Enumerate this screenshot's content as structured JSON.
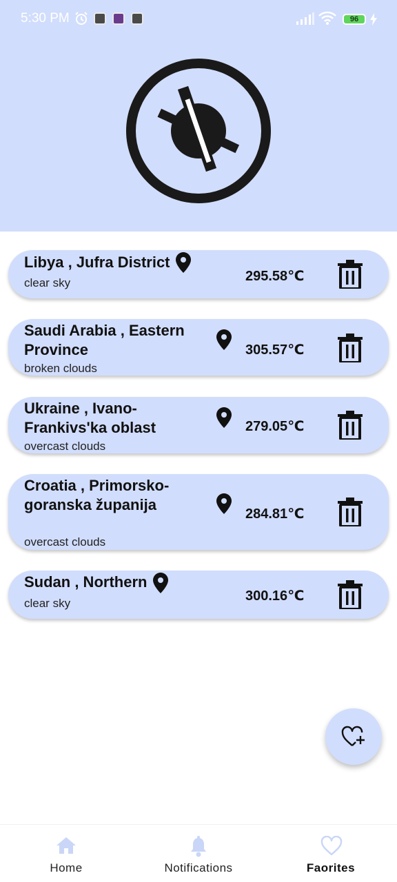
{
  "status_bar": {
    "time": "5:30 PM",
    "battery": "96",
    "icons": [
      "alarm-icon",
      "app-icon",
      "app-icon",
      "app-icon",
      "signal-icon",
      "wifi-icon",
      "battery-icon",
      "charging-icon"
    ]
  },
  "header": {
    "logo_icon": "compass-logo-icon",
    "background": "#d1ddfc"
  },
  "favorites": [
    {
      "title": "Libya , Jufra District",
      "description": "clear sky",
      "temperature": "295.58℃"
    },
    {
      "title": "Saudi Arabia , Eastern Province",
      "description": "broken clouds",
      "temperature": "305.57℃"
    },
    {
      "title": "Ukraine , Ivano-Frankivs'ka oblast",
      "description": "overcast clouds",
      "temperature": "279.05℃"
    },
    {
      "title": "Croatia , Primorsko-goranska županija",
      "description": "overcast clouds",
      "temperature": "284.81℃"
    },
    {
      "title": "Sudan , Northern",
      "description": "clear sky",
      "temperature": "300.16℃"
    }
  ],
  "fab": {
    "icon": "heart-plus-icon"
  },
  "bottom_nav": {
    "home": "Home",
    "notifications": "Notifications",
    "favorites": "Faorites",
    "active": "favorites"
  },
  "colors": {
    "accent": "#d1ddfc",
    "nav_icon": "#c9d6f7"
  }
}
